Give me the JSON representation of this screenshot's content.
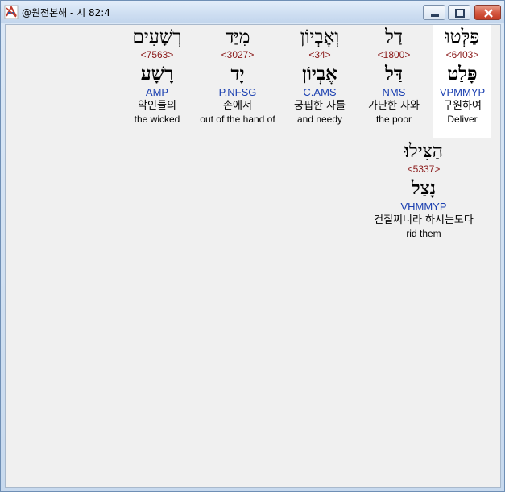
{
  "window": {
    "title": "@원전본해 - 시 82:4"
  },
  "words": [
    {
      "hebrew": "פַּלְּטוּ",
      "strong": "<6403>",
      "lemma": "פָּלַט",
      "parse": "VPMMYP",
      "korean": "구원하여",
      "english": "Deliver",
      "highlighted": true
    },
    {
      "hebrew": "דַל",
      "strong": "<1800>",
      "lemma": "דַּל",
      "parse": "NMS",
      "korean": "가난한 자와",
      "english": "the poor",
      "highlighted": false
    },
    {
      "hebrew": "וְאֶבְיוֹן",
      "strong": "<34>",
      "lemma": "אֶבְיוֹן",
      "parse": "C.AMS",
      "korean": "궁핍한 자를",
      "english": "and needy",
      "highlighted": false
    },
    {
      "hebrew": "מִיַּד",
      "strong": "<3027>",
      "lemma": "יָד",
      "parse": "P.NFSG",
      "korean": "손에서",
      "english": "out of the hand of",
      "highlighted": false
    },
    {
      "hebrew": "רְשָׁעִים",
      "strong": "<7563>",
      "lemma": "רָשָׁע",
      "parse": "AMP",
      "korean": "악인들의",
      "english": "the wicked",
      "highlighted": false
    },
    {
      "hebrew": "הַצִּילוּ׃",
      "strong": "<5337>",
      "lemma": "נָצַל",
      "parse": "VHMMYP",
      "korean": "건질찌니라 하시는도다",
      "english": "rid them",
      "highlighted": false
    }
  ]
}
